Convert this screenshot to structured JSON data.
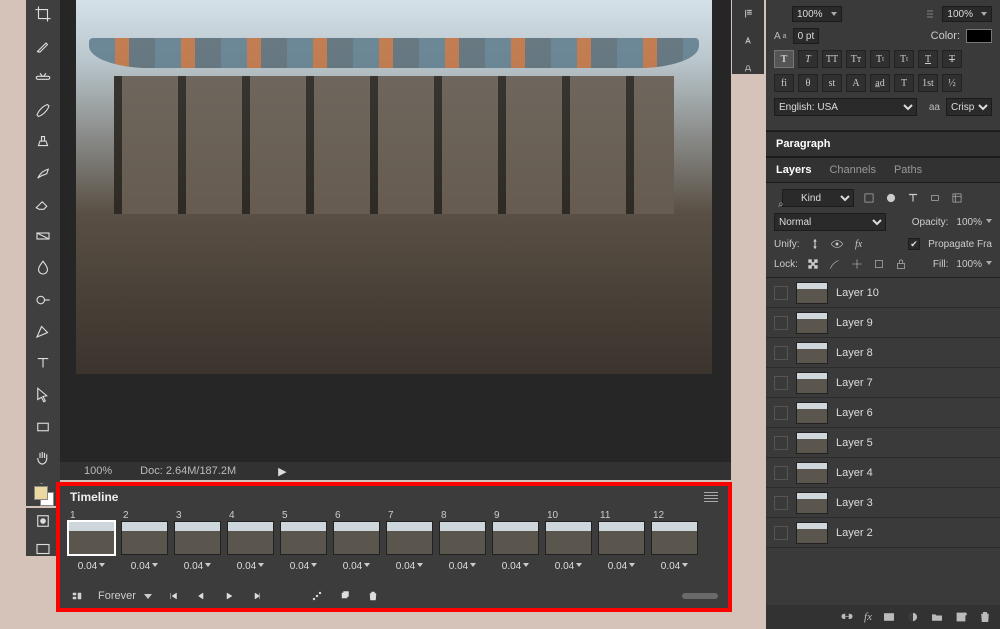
{
  "status": {
    "zoom": "100%",
    "doc": "Doc: 2.64M/187.2M"
  },
  "timeline": {
    "title": "Timeline",
    "loop": "Forever",
    "frames": [
      {
        "n": "1",
        "dur": "0.04"
      },
      {
        "n": "2",
        "dur": "0.04"
      },
      {
        "n": "3",
        "dur": "0.04"
      },
      {
        "n": "4",
        "dur": "0.04"
      },
      {
        "n": "5",
        "dur": "0.04"
      },
      {
        "n": "6",
        "dur": "0.04"
      },
      {
        "n": "7",
        "dur": "0.04"
      },
      {
        "n": "8",
        "dur": "0.04"
      },
      {
        "n": "9",
        "dur": "0.04"
      },
      {
        "n": "10",
        "dur": "0.04"
      },
      {
        "n": "11",
        "dur": "0.04"
      },
      {
        "n": "12",
        "dur": "0.04"
      }
    ]
  },
  "character": {
    "size": "100%",
    "leading": "100%",
    "baseline": "0 pt",
    "color_label": "Color:",
    "language": "English: USA",
    "aa_label": "aa",
    "aa_mode": "Crisp",
    "style_row2": [
      "fi",
      "θ",
      "st",
      "A",
      "a̲d",
      "T",
      "1st",
      "½"
    ]
  },
  "paragraph": {
    "title": "Paragraph"
  },
  "layers_panel": {
    "tabs": [
      "Layers",
      "Channels",
      "Paths"
    ],
    "filter": "Kind",
    "blend": "Normal",
    "opacity_label": "Opacity:",
    "opacity": "100%",
    "unify_label": "Unify:",
    "propagate_label": "Propagate Fra",
    "lock_label": "Lock:",
    "fill_label": "Fill:",
    "fill": "100%",
    "layers": [
      {
        "name": "Layer 10"
      },
      {
        "name": "Layer 9"
      },
      {
        "name": "Layer 8"
      },
      {
        "name": "Layer 7"
      },
      {
        "name": "Layer 6"
      },
      {
        "name": "Layer 5"
      },
      {
        "name": "Layer 4"
      },
      {
        "name": "Layer 3"
      },
      {
        "name": "Layer 2"
      }
    ]
  }
}
